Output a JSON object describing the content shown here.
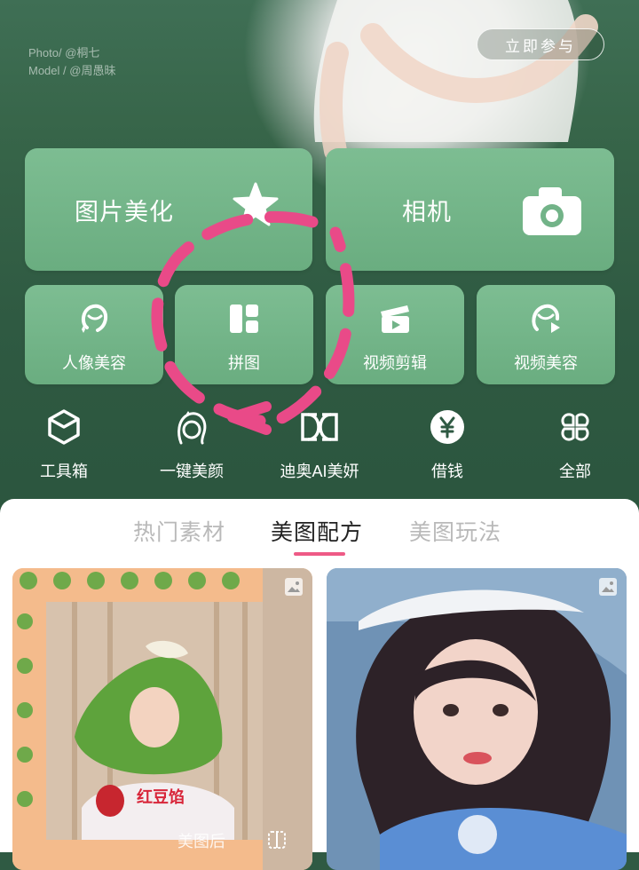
{
  "banner": {
    "photo_credit": "Photo/ @桐七",
    "model_credit": "Model / @周愚昧",
    "join_button": "立即参与"
  },
  "main_features": [
    {
      "label": "图片美化",
      "icon": "star-icon"
    },
    {
      "label": "相机",
      "icon": "camera-icon"
    }
  ],
  "sub_features": [
    {
      "label": "人像美容",
      "icon": "face-sparkle-icon"
    },
    {
      "label": "拼图",
      "icon": "collage-grid-icon"
    },
    {
      "label": "视频剪辑",
      "icon": "clapperboard-icon"
    },
    {
      "label": "视频美容",
      "icon": "face-play-icon"
    }
  ],
  "tools": [
    {
      "label": "工具箱",
      "icon": "cube-icon"
    },
    {
      "label": "一键美颜",
      "icon": "beauty-face-icon"
    },
    {
      "label": "迪奥AI美妍",
      "icon": "dior-logo-icon"
    },
    {
      "label": "借钱",
      "icon": "yen-icon"
    },
    {
      "label": "全部",
      "icon": "four-leaf-grid-icon"
    }
  ],
  "tabs": [
    {
      "label": "热门素材",
      "active": false
    },
    {
      "label": "美图配方",
      "active": true
    },
    {
      "label": "美图玩法",
      "active": false
    }
  ],
  "thumbnails": [
    {
      "caption": "美图后",
      "sticker_text": "红豆馅"
    },
    {
      "caption": ""
    }
  ],
  "colors": {
    "background_green": "#2f5a43",
    "card_green": "#74b68a",
    "accent_pink": "#ee5a86"
  }
}
